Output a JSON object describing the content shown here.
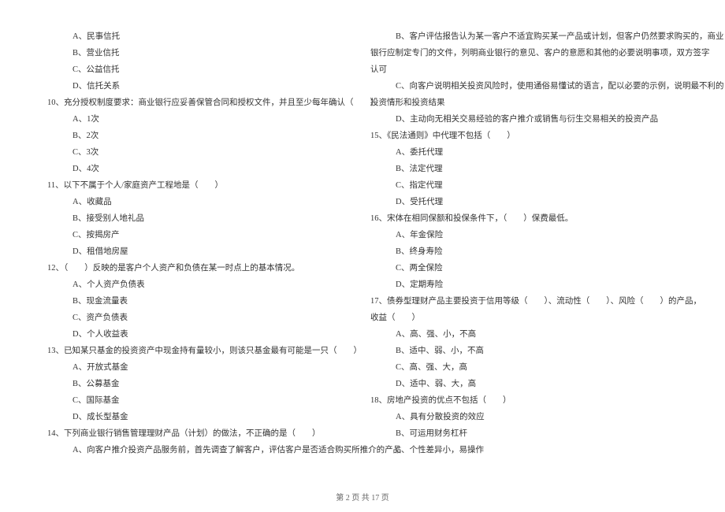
{
  "left": {
    "q9_opts": [
      "A、民事信托",
      "B、营业信托",
      "C、公益信托",
      "D、信托关系"
    ],
    "q10": "10、充分授权制度要求：商业银行应妥善保管合同和授权文件，并且至少每年确认（　　）",
    "q10_opts": [
      "A、1次",
      "B、2次",
      "C、3次",
      "D、4次"
    ],
    "q11": "11、以下不属于个人/家庭资产工程地是（　　）",
    "q11_opts": [
      "A、收藏品",
      "B、接受别人地礼品",
      "C、按揭房产",
      "D、租借地房屋"
    ],
    "q12": "12、（　　）反映的是客户个人资产和负债在某一时点上的基本情况。",
    "q12_opts": [
      "A、个人资产负债表",
      "B、现金流量表",
      "C、资产负债表",
      "D、个人收益表"
    ],
    "q13": "13、已知某只基金的投资资产中现金持有量较小，则该只基金最有可能是一只（　　）",
    "q13_opts": [
      "A、开放式基金",
      "B、公募基金",
      "C、国际基金",
      "D、成长型基金"
    ],
    "q14": "14、下列商业银行销售管理理财产品（计划）的做法，不正确的是（　　）",
    "q14_optA": "A、向客户推介投资产品服务前，首先调查了解客户，评估客户是否适合购买所推介的产品"
  },
  "right": {
    "q14_optB_l1": "B、客户评估报告认为某一客户不适宜购买某一产品或计划，但客户仍然要求购买的，商业",
    "q14_optB_l2": "银行应制定专门的文件，列明商业银行的意见、客户的意愿和其他的必要说明事项，双方签字",
    "q14_optB_l3": "认可",
    "q14_optC_l1": "C、向客户说明相关投资风险时，使用通俗易懂试的语言，配以必要的示例，说明最不利的",
    "q14_optC_l2": "投资情形和投资结果",
    "q14_optD": "D、主动向无相关交易经验的客户推介或销售与衍生交易相关的投资产品",
    "q15": "15、《民法通则》中代理不包括（　　）",
    "q15_opts": [
      "A、委托代理",
      "B、法定代理",
      "C、指定代理",
      "D、受托代理"
    ],
    "q16": "16、宋体在相同保额和投保条件下，（　　）保费最低。",
    "q16_opts": [
      "A、年金保险",
      "B、终身寿险",
      "C、两全保险",
      "D、定期寿险"
    ],
    "q17_l1": "17、债券型理财产品主要投资于信用等级（　　）、流动性（　　）、风险（　　）的产品，",
    "q17_l2": "收益（　　）",
    "q17_opts": [
      "A、高、强、小，不高",
      "B、适中、弱、小，不高",
      "C、高、强、大，高",
      "D、适中、弱、大，高"
    ],
    "q18": "18、房地产投资的优点不包括（　　）",
    "q18_opts": [
      "A、具有分散投资的效应",
      "B、可运用财务杠杆",
      "C、个性差异小，易操作"
    ]
  },
  "footer": "第 2 页 共 17 页"
}
